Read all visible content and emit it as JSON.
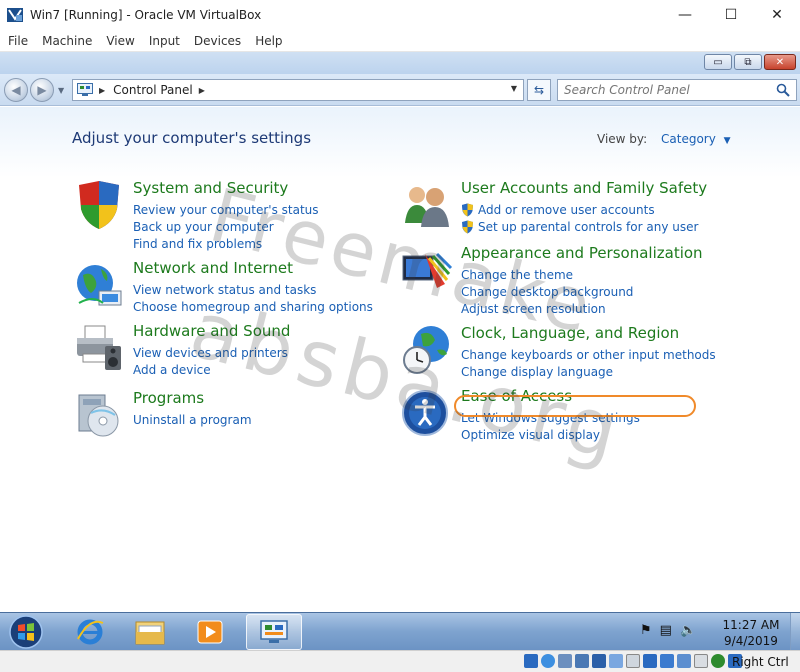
{
  "host": {
    "title": "Win7 [Running] - Oracle VM VirtualBox",
    "controls": {
      "minimize": "—",
      "maximize": "☐",
      "close": "✕"
    },
    "menu": [
      "File",
      "Machine",
      "View",
      "Input",
      "Devices",
      "Help"
    ],
    "host_key_label": "Right Ctrl"
  },
  "guest_window": {
    "buttons": {
      "minimize": "▭",
      "restore": "⧉",
      "close": "✕"
    }
  },
  "navbar": {
    "breadcrumb": "Control Panel",
    "search_placeholder": "Search Control Panel"
  },
  "content": {
    "heading": "Adjust your computer's settings",
    "view_by_label": "View by:",
    "view_by_value": "Category",
    "categories": [
      {
        "title": "System and Security",
        "links": [
          "Review your computer's status",
          "Back up your computer",
          "Find and fix problems"
        ]
      },
      {
        "title": "Network and Internet",
        "links": [
          "View network status and tasks",
          "Choose homegroup and sharing options"
        ]
      },
      {
        "title": "Hardware and Sound",
        "links": [
          "View devices and printers",
          "Add a device"
        ]
      },
      {
        "title": "Programs",
        "links": [
          "Uninstall a program"
        ]
      },
      {
        "title": "User Accounts and Family Safety",
        "links": [
          "Add or remove user accounts",
          "Set up parental controls for any user"
        ]
      },
      {
        "title": "Appearance and Personalization",
        "links": [
          "Change the theme",
          "Change desktop background",
          "Adjust screen resolution"
        ]
      },
      {
        "title": "Clock, Language, and Region",
        "links": [
          "Change keyboards or other input methods",
          "Change display language"
        ]
      },
      {
        "title": "Ease of Access",
        "links": [
          "Let Windows suggest settings",
          "Optimize visual display"
        ]
      }
    ],
    "watermark": [
      "Freemake",
      "absba.org"
    ]
  },
  "taskbar": {
    "time": "11:27 AM",
    "date": "9/4/2019"
  },
  "colors": {
    "category_title": "#1d7a1d",
    "link": "#1a5fb4",
    "heading": "#1e3a76",
    "highlight": "#f08a2a"
  }
}
